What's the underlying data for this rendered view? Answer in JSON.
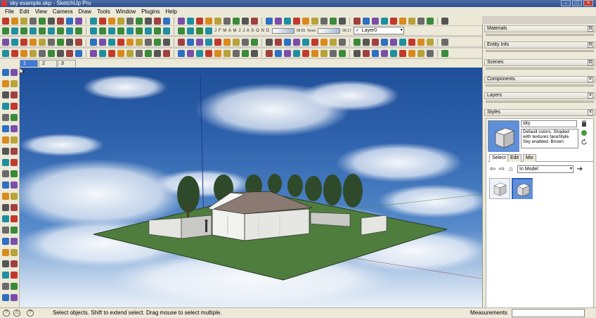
{
  "window": {
    "title": "sky example.skp - SketchUp Pro",
    "controls": [
      "–",
      "□",
      "×"
    ]
  },
  "menu": [
    "File",
    "Edit",
    "View",
    "Camera",
    "Draw",
    "Tools",
    "Window",
    "Plugins",
    "Help"
  ],
  "shadows": {
    "months": "J F M A M J J A S O N D",
    "time_start": "06:55",
    "time_mid": "Noon",
    "time_end": "06:17"
  },
  "layer": {
    "current": "Layer0",
    "check": "✓",
    "arrow": "▾"
  },
  "scene_tabs": [
    "1",
    "2",
    "3"
  ],
  "tray": {
    "panels": [
      {
        "label": "Materials",
        "icon": "⊟"
      },
      {
        "label": "Entity Info",
        "icon": "⊟"
      },
      {
        "label": "Scenes",
        "icon": "⊟"
      },
      {
        "label": "Components",
        "icon": "✕"
      },
      {
        "label": "Layers",
        "icon": "✕"
      },
      {
        "label": "Styles",
        "icon": "✕"
      }
    ],
    "styles": {
      "name": "sky",
      "description": "Default colors. Shaded with textures faceStyle. Sky enabled. Brown",
      "tabs": [
        "Select",
        "Edit",
        "Mix"
      ],
      "collection": "In Model",
      "collection_arrow": "▾",
      "nav": {
        "back": "⇦",
        "forward": "⇨",
        "home": "⌂",
        "details": "➔"
      }
    }
  },
  "status": {
    "icons": [
      "?",
      "⚠",
      "?"
    ],
    "message": "Select objects. Shift to extend select. Drag mouse to select multiple.",
    "measurements_label": "Measurements"
  },
  "colors": {
    "sky_top": "#1f4f99",
    "grass": "#4f7d3e",
    "selection_blue": "#3d7ad6",
    "chrome": "#ece9d8"
  }
}
